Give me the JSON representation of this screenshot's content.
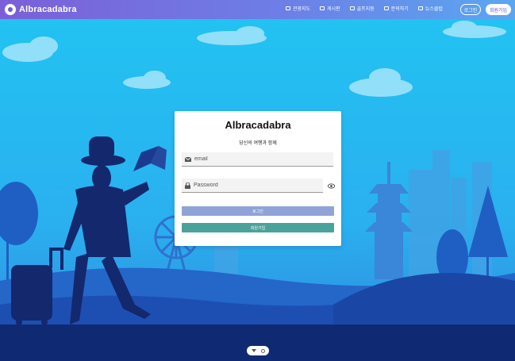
{
  "header": {
    "brand": "Albracadabra",
    "nav": [
      {
        "label": "관광지도"
      },
      {
        "label": "게시판"
      },
      {
        "label": "골프지동"
      },
      {
        "label": "문의하기"
      },
      {
        "label": "뉴스클럽"
      }
    ],
    "login_label": "로그인",
    "signup_label": "회원가입"
  },
  "login_card": {
    "title": "Albracadabra",
    "subtitle": "당신의 여행과 함께",
    "email_placeholder": "email",
    "password_placeholder": "Password",
    "login_button": "로그인",
    "signup_button": "회원가입"
  },
  "icons": {
    "email": "mail-icon",
    "password": "lock-icon",
    "show_password": "eye-icon",
    "logo": "logo-icon"
  },
  "colors": {
    "header_gradient_start": "#7c5fd8",
    "header_gradient_end": "#5aa7f0",
    "login_button": "#8fa3d6",
    "signup_button": "#4aa39a"
  }
}
